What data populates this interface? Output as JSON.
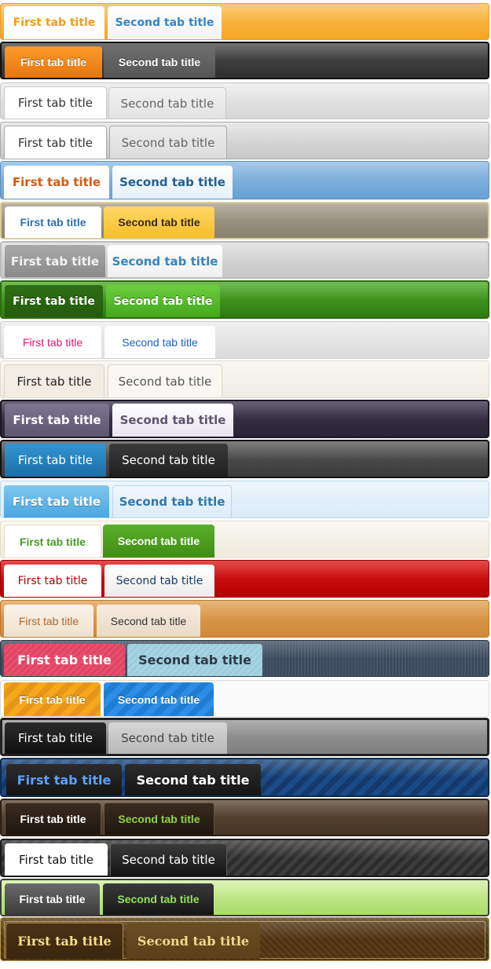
{
  "tab_sets": [
    {
      "tabs": [
        "First tab title",
        "Second tab title"
      ]
    },
    {
      "tabs": [
        "First tab title",
        "Second tab title"
      ]
    },
    {
      "tabs": [
        "First tab title",
        "Second tab title"
      ]
    },
    {
      "tabs": [
        "First tab title",
        "Second tab title"
      ]
    },
    {
      "tabs": [
        "First tab title",
        "Second tab title"
      ]
    },
    {
      "tabs": [
        "First tab title",
        "Second tab title"
      ]
    },
    {
      "tabs": [
        "First tab title",
        "Second tab title"
      ]
    },
    {
      "tabs": [
        "First tab title",
        "Second tab title"
      ]
    },
    {
      "tabs": [
        "First tab title",
        "Second tab title"
      ]
    },
    {
      "tabs": [
        "First tab title",
        "Second tab title"
      ]
    },
    {
      "tabs": [
        "First tab title",
        "Second tab title"
      ]
    },
    {
      "tabs": [
        "First tab title",
        "Second tab title"
      ]
    },
    {
      "tabs": [
        "First tab title",
        "Second tab title"
      ]
    },
    {
      "tabs": [
        "First tab title",
        "Second tab title"
      ]
    },
    {
      "tabs": [
        "First tab title",
        "Second tab title"
      ]
    },
    {
      "tabs": [
        "First tab title",
        "Second tab title"
      ]
    },
    {
      "tabs": [
        "First tab title",
        "Second tab title"
      ]
    },
    {
      "tabs": [
        "First tab title",
        "Second tab title"
      ]
    },
    {
      "tabs": [
        "First tab title",
        "Second tab title"
      ]
    },
    {
      "tabs": [
        "First tab title",
        "Second tab title"
      ]
    },
    {
      "tabs": [
        "First tab title",
        "Second tab title"
      ]
    },
    {
      "tabs": [
        "First tab title",
        "Second tab title"
      ]
    },
    {
      "tabs": [
        "First tab title",
        "Second tab title"
      ]
    },
    {
      "tabs": [
        "First tab title",
        "Second tab title"
      ]
    }
  ],
  "colors": {
    "orange_accent": "#f5a623",
    "green_accent": "#3d8f1a",
    "blue_accent": "#2a7ab8",
    "red_accent": "#c40000"
  }
}
